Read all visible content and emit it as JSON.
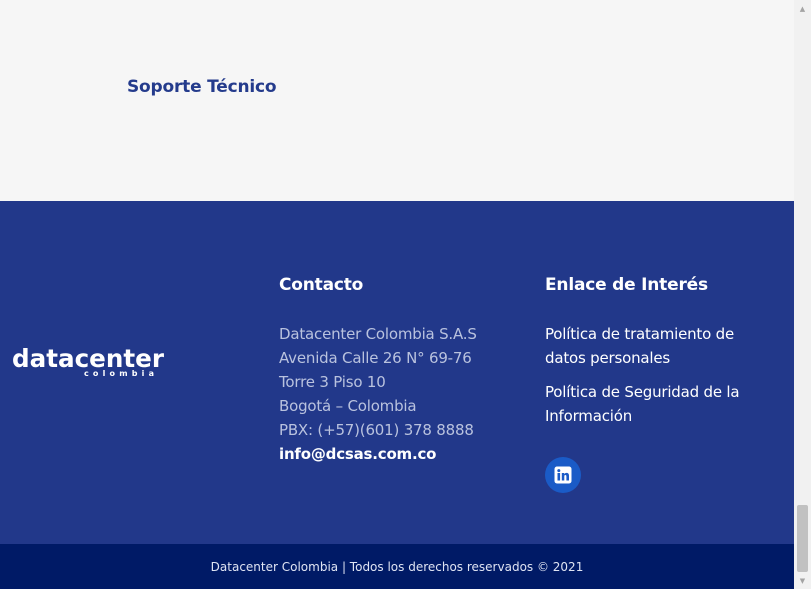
{
  "support": {
    "title": "Soporte Técnico"
  },
  "footer": {
    "logo": {
      "main": "datacenter",
      "sub": "colombia"
    },
    "contact": {
      "title": "Contacto",
      "lines": [
        "Datacenter Colombia S.A.S",
        "Avenida Calle 26 N° 69-76",
        "Torre 3 Piso 10",
        "Bogotá – Colombia",
        "PBX: (+57)(601) 378 8888"
      ],
      "email": "info@dcsas.com.co"
    },
    "links": {
      "title": "Enlace de Interés",
      "items": [
        "Política de tratamiento de datos personales",
        "Política de Seguridad de la Información"
      ],
      "social_icon": "linkedin-icon"
    },
    "copyright": "Datacenter Colombia | Todos los derechos reservados © 2021"
  },
  "colors": {
    "brand_blue": "#22388a",
    "bottom_bar": "#001a66",
    "title_blue": "#243b8c",
    "linkedin_blue": "#1a5bc7"
  }
}
